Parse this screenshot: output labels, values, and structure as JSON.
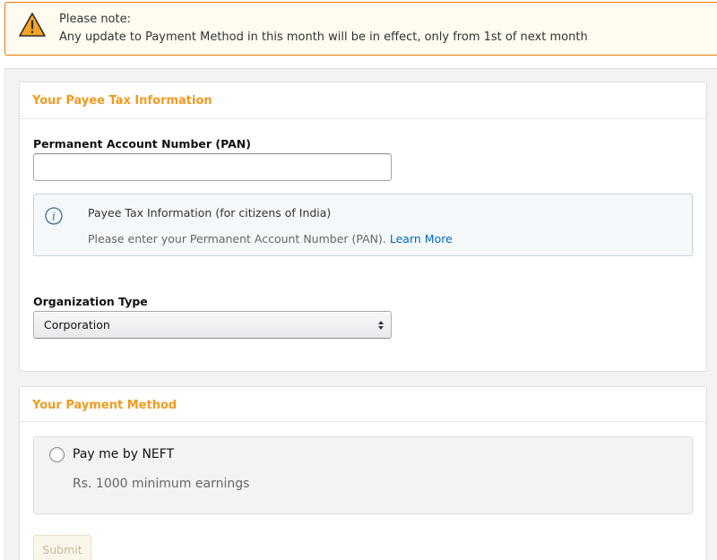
{
  "alert": {
    "icon": "warning-icon",
    "title": "Please note:",
    "message": "Any update to Payment Method in this month will be in effect, only from 1st of next month",
    "border_color": "#e77600",
    "background": "#fffbf0"
  },
  "tax_section": {
    "header": "Your Payee Tax Information",
    "pan_label": "Permanent Account Number (PAN)",
    "pan_value": "",
    "pan_placeholder": "",
    "info": {
      "icon": "info-icon",
      "title": "Payee Tax Information (for citizens of India)",
      "description": "Please enter your Permanent Account Number (PAN).",
      "link": "Learn More"
    },
    "org_type_label": "Organization Type",
    "org_type_selected": "Corporation"
  },
  "payment_section": {
    "header": "Your Payment Method",
    "options": [
      {
        "label": "Pay me by NEFT",
        "description": "Rs. 1000 minimum earnings",
        "selected": false
      }
    ]
  },
  "submit_label": "Submit",
  "colors": {
    "section_header": "#f39a1e",
    "link": "#0066c0",
    "submit_disabled_bg": "#fbf6ea"
  }
}
